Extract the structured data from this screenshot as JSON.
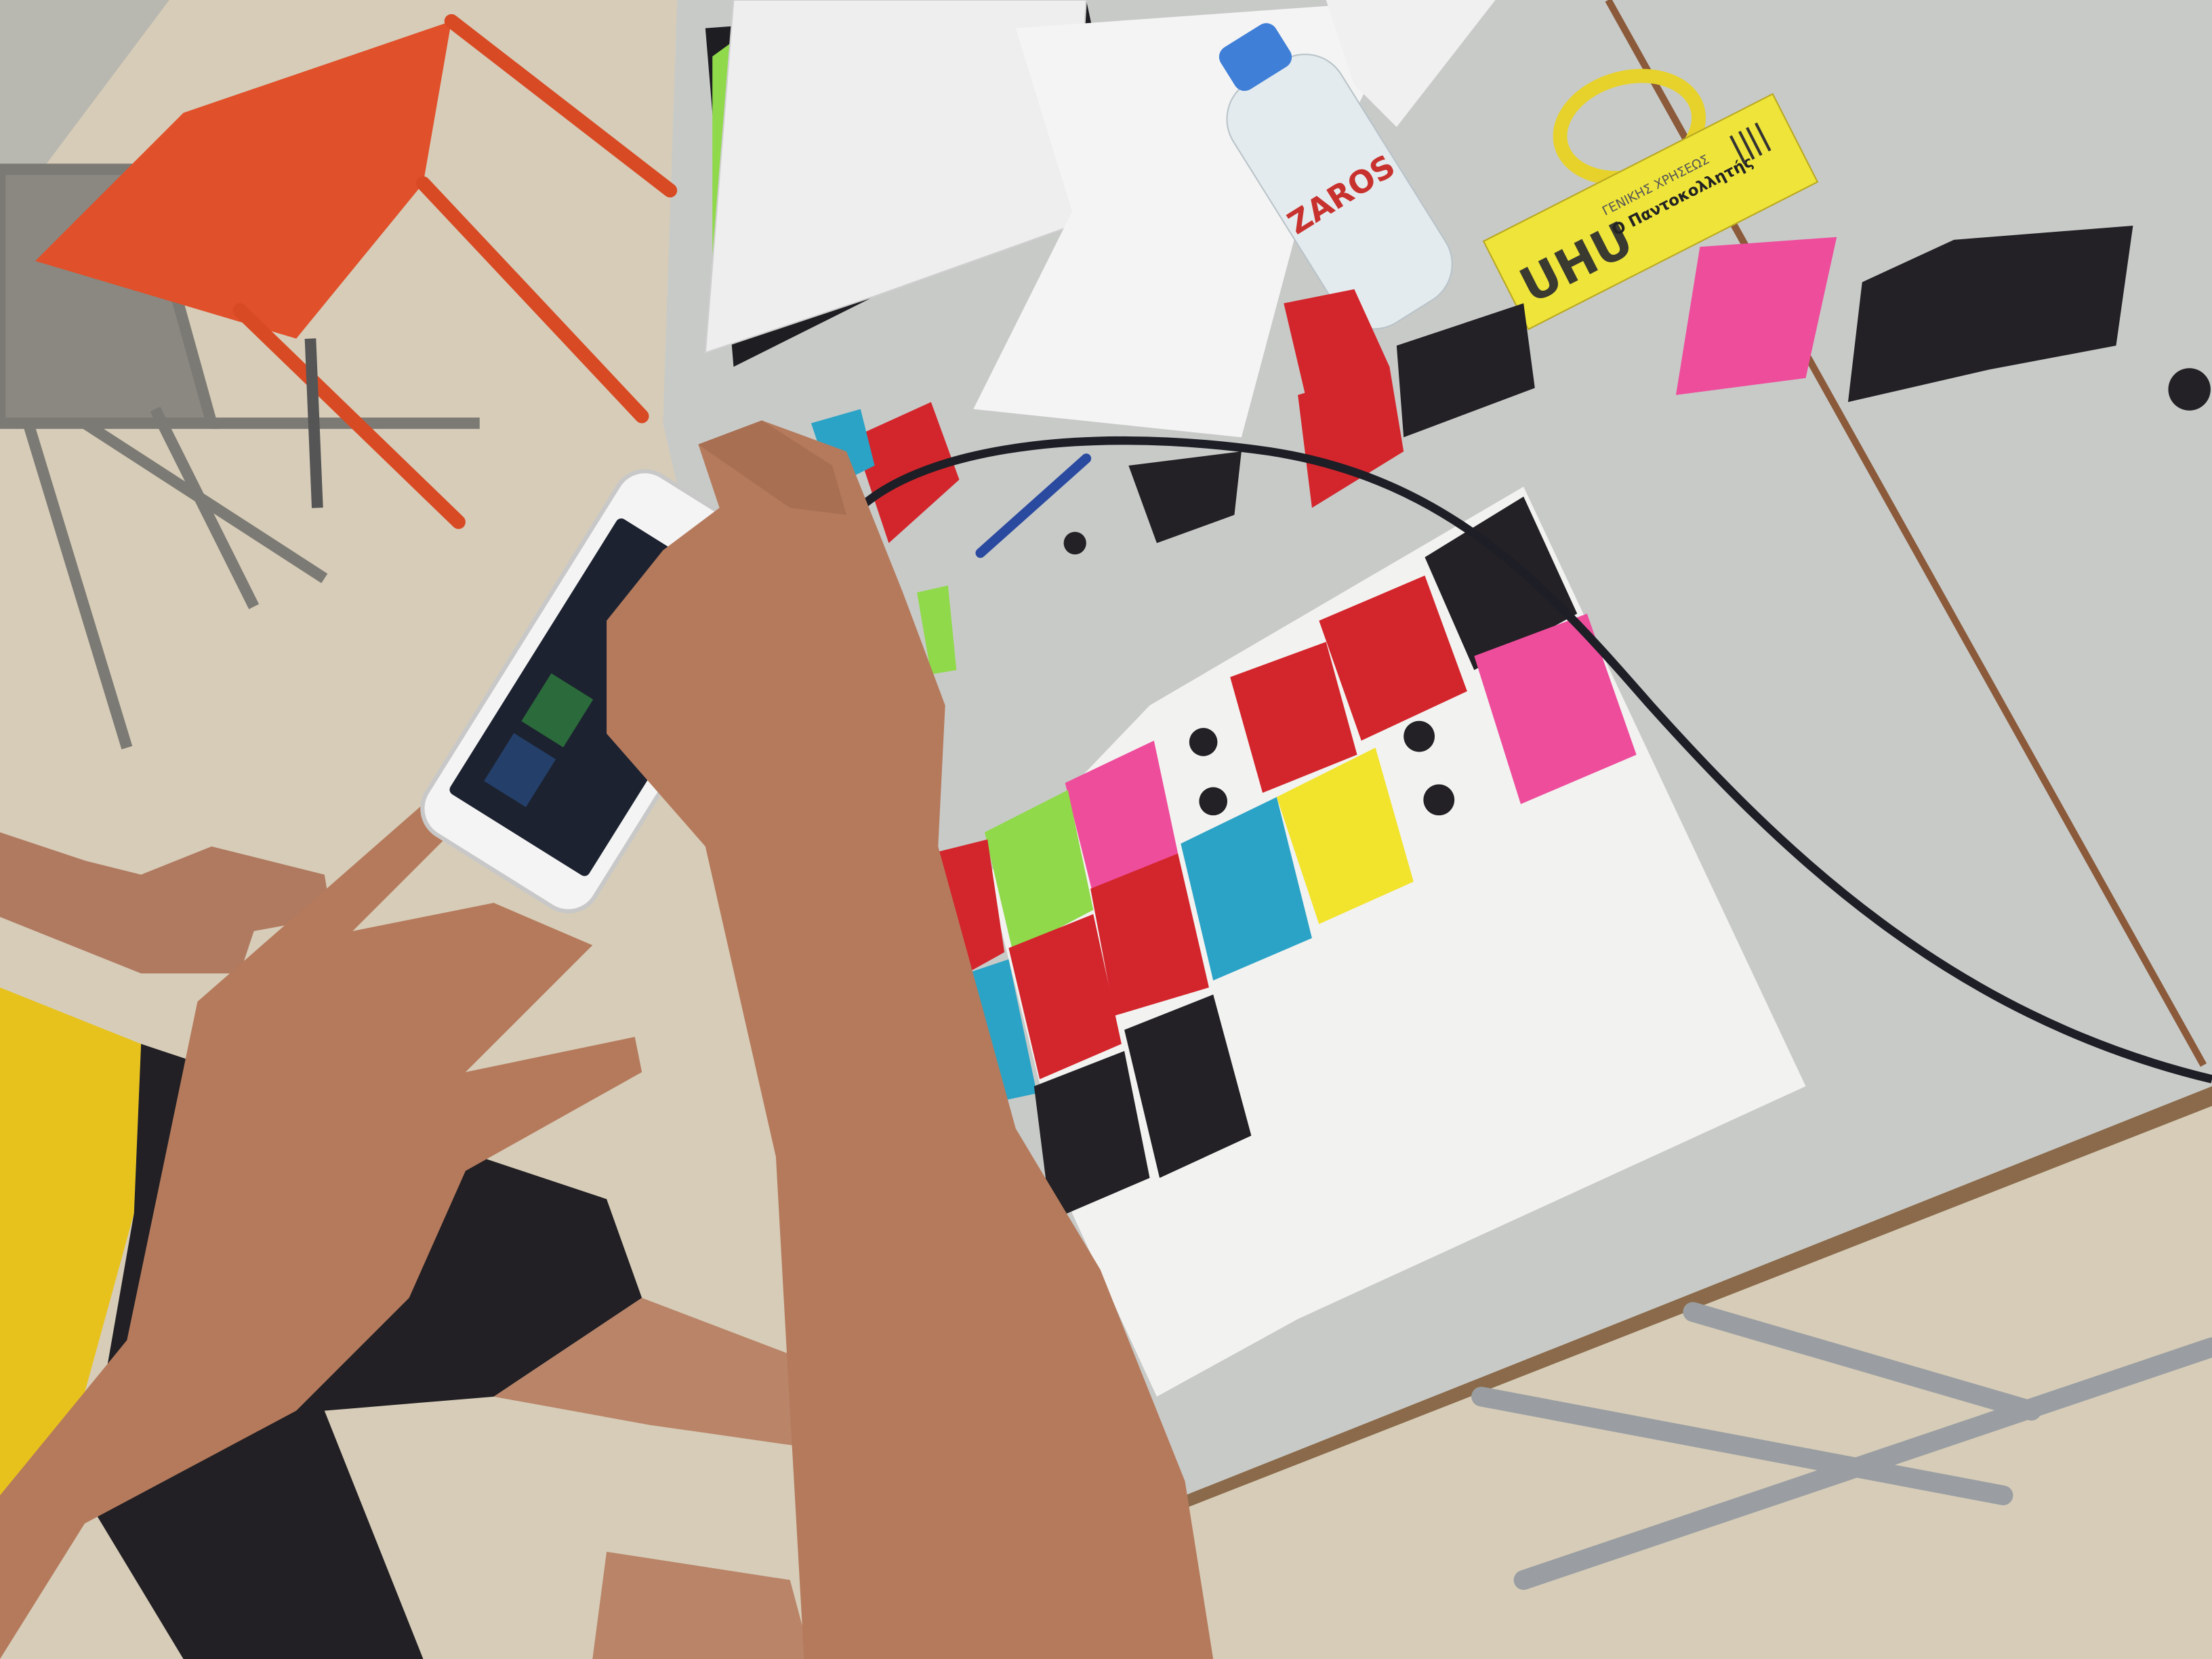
{
  "scene": {
    "description_labels": {
      "bottle_brand": "ZAROS",
      "glue_brand": "UHU",
      "glue_subtitle": "ΓΕΝΙΚΗΣ ΧΡΗΣΕΩΣ",
      "glue_name": "Ο Παντοκολλητής"
    }
  },
  "colors": {
    "floor": "#d6ccb8",
    "table": "#c8cac8",
    "table_edge": "#8a5a3a",
    "paper": "#f2f2f0",
    "red": "#d3262c",
    "pink": "#ee4d9c",
    "green": "#8fd94a",
    "cyan": "#2aa3c6",
    "yellow": "#f2e32c",
    "black": "#232125",
    "skin": "#b57a5c",
    "chair": "#e0502a",
    "shirt": "#e8c21c",
    "glue_box": "#eee43a"
  }
}
